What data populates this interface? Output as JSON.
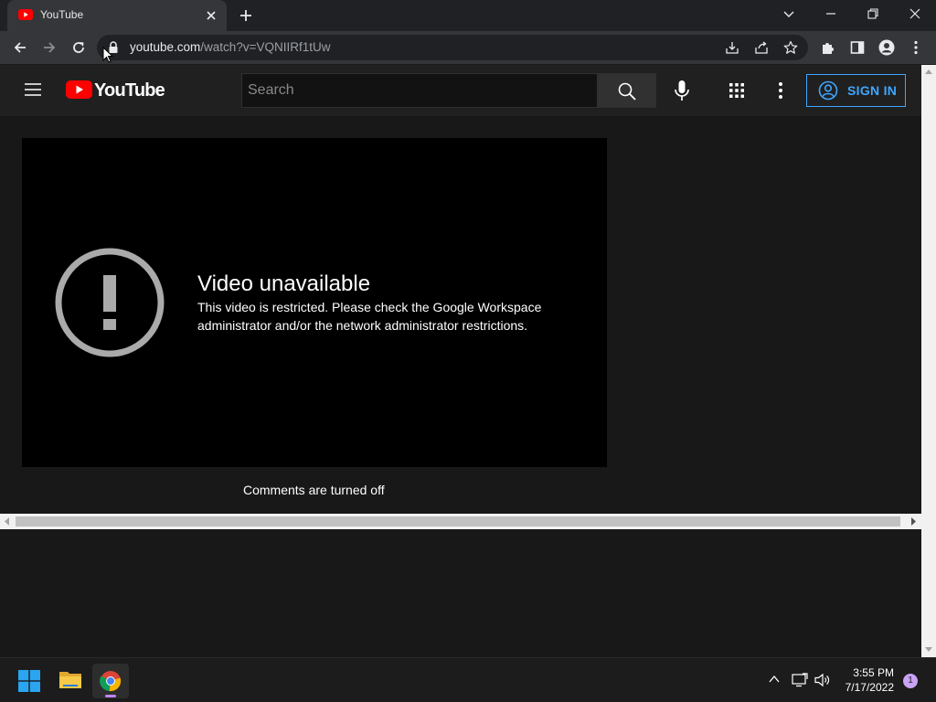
{
  "colors": {
    "yt_red": "#ff0000",
    "signin_blue": "#3ea6ff",
    "chrome_frame": "#202124",
    "chrome_toolbar": "#35363a",
    "page_bg": "#181818",
    "header_bg": "#202020"
  },
  "browser": {
    "tab": {
      "title": "YouTube",
      "favicon": "youtube-favicon"
    },
    "toolbar": {
      "url_host": "youtube.com",
      "url_path": "/watch?v=VQNIIRf1tUw",
      "icons": [
        "back-icon",
        "forward-icon",
        "reload-icon",
        "lock-icon",
        "install-icon",
        "share-icon",
        "bookmark-star-icon",
        "extensions-icon",
        "side-panel-icon",
        "profile-icon",
        "chrome-menu-icon"
      ]
    },
    "window_controls": [
      "tab-search-icon",
      "minimize-icon",
      "restore-icon",
      "close-icon"
    ]
  },
  "youtube": {
    "logo_text": "YouTube",
    "search": {
      "placeholder": "Search",
      "value": ""
    },
    "signin_label": "SIGN IN",
    "error": {
      "title": "Video unavailable",
      "message": "This video is restricted. Please check the Google Workspace administrator and/or the network administrator restrictions."
    },
    "comments_text": "Comments are turned off"
  },
  "taskbar": {
    "apps": [
      "windows-start-icon",
      "file-explorer-icon",
      "chrome-icon"
    ],
    "tray": [
      "chevron-up-icon",
      "network-icon",
      "volume-icon"
    ],
    "time": "3:55 PM",
    "date": "7/17/2022",
    "notification_count": "1"
  }
}
